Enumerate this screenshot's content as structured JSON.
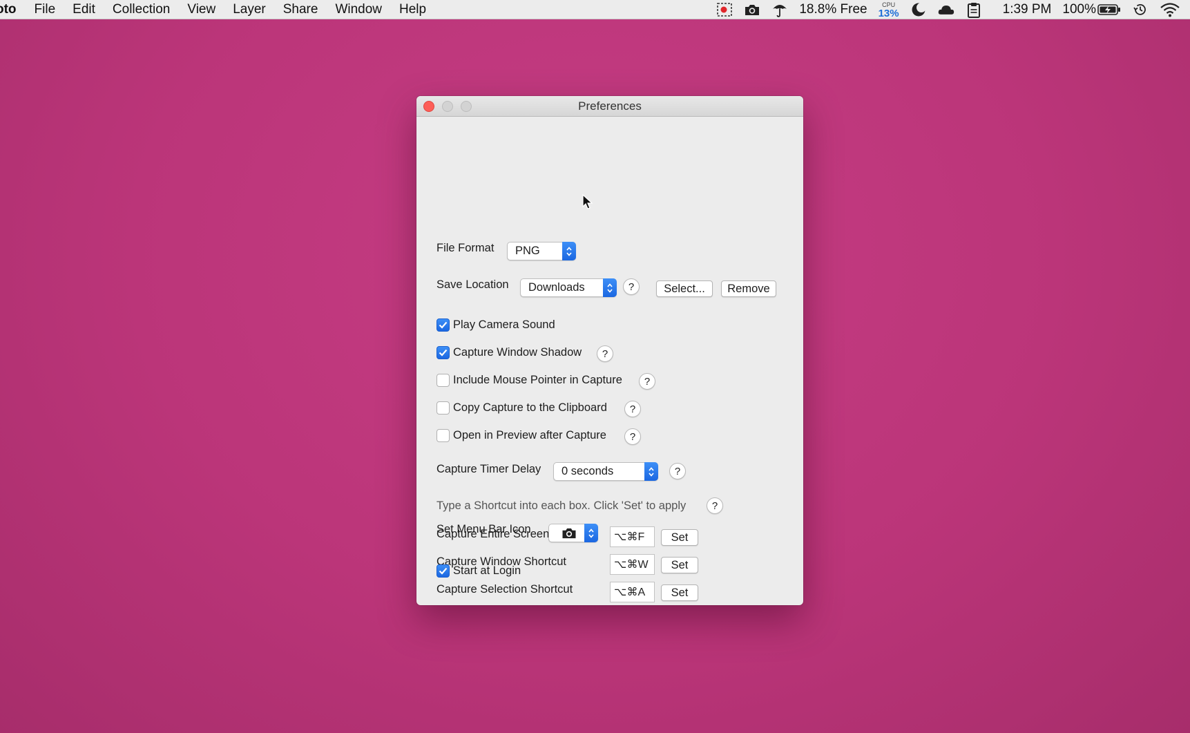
{
  "menubar": {
    "app_name": "oto",
    "items": [
      "File",
      "Edit",
      "Collection",
      "View",
      "Layer",
      "Share",
      "Window",
      "Help"
    ],
    "status": {
      "memory_free": "18.8% Free",
      "cpu_label": "CPU",
      "cpu_value": "13%",
      "clock": "1:39 PM",
      "battery": "100%"
    },
    "status_icons": [
      "screen-record-icon",
      "camera-icon",
      "umbrella-icon",
      "cpu-meter",
      "moon-icon",
      "cloud-icon",
      "clipboard-icon",
      "battery-icon",
      "time-machine-icon",
      "wifi-icon"
    ]
  },
  "window": {
    "title": "Preferences",
    "file_format": {
      "label": "File Format",
      "value": "PNG"
    },
    "save_location": {
      "label": "Save Location",
      "value": "Downloads",
      "help": "?",
      "select_button": "Select...",
      "remove_button": "Remove"
    },
    "options": [
      {
        "label": "Play Camera Sound",
        "checked": true,
        "help": ""
      },
      {
        "label": "Capture Window Shadow",
        "checked": true,
        "help": "?"
      },
      {
        "label": "Include Mouse Pointer in Capture",
        "checked": false,
        "help": "?"
      },
      {
        "label": "Copy Capture to the Clipboard",
        "checked": false,
        "help": "?"
      },
      {
        "label": "Open in Preview after Capture",
        "checked": false,
        "help": "?"
      }
    ],
    "timer": {
      "label": "Capture Timer Delay",
      "value": "0 seconds",
      "help": "?"
    },
    "shortcut_info": {
      "text": "Type a Shortcut into each box. Click 'Set' to apply",
      "help": "?"
    },
    "shortcuts": [
      {
        "label": "Capture Entire Screen Shortcut",
        "value": "⌥⌘F",
        "button": "Set"
      },
      {
        "label": "Capture Window Shortcut",
        "value": "⌥⌘W",
        "button": "Set"
      },
      {
        "label": "Capture Selection Shortcut",
        "value": "⌥⌘A",
        "button": "Set"
      }
    ],
    "menu_bar_icon": {
      "label": "Set Menu Bar Icon",
      "icon": "camera-icon"
    },
    "start_at_login": {
      "label": "Start at Login",
      "checked": true
    }
  },
  "colors": {
    "desktop": "#c63d84",
    "accent": "#1b67e1",
    "close_button": "#fd5e57"
  }
}
